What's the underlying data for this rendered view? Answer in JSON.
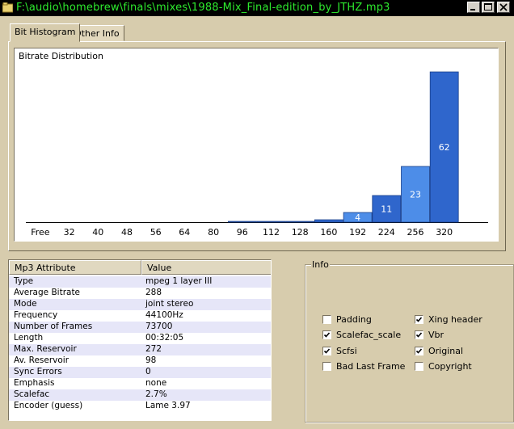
{
  "window": {
    "title": "F:\\audio\\homebrew\\finals\\mixes\\1988-Mix_Final-edition_by_JTHZ.mp3",
    "controls": [
      "minimize",
      "maximize",
      "close"
    ]
  },
  "tabs": [
    {
      "label": "Bit Histogram",
      "active": true
    },
    {
      "label": "Other Info",
      "active": false
    }
  ],
  "chart_data": {
    "type": "bar",
    "title": "Bitrate Distribution",
    "categories": [
      "Free",
      "32",
      "40",
      "48",
      "56",
      "64",
      "80",
      "96",
      "112",
      "128",
      "160",
      "192",
      "224",
      "256",
      "320"
    ],
    "values": [
      0,
      0,
      0,
      0,
      0,
      0,
      0,
      0.3,
      0.3,
      0.3,
      1,
      4,
      11,
      23,
      62
    ],
    "data_labels": [
      "",
      "",
      "",
      "",
      "",
      "",
      "",
      "",
      "",
      "",
      "",
      "4",
      "11",
      "23",
      "62"
    ],
    "ylim": [
      0,
      62
    ],
    "colors": {
      "bar_dark": "#2f66cc",
      "bar_light": "#4d8de8"
    },
    "grid": false
  },
  "attributes": {
    "columns": [
      "Mp3 Attribute",
      "Value"
    ],
    "rows": [
      [
        "Type",
        "mpeg 1 layer III"
      ],
      [
        "Average Bitrate",
        "288"
      ],
      [
        "Mode",
        "joint stereo"
      ],
      [
        "Frequency",
        "44100Hz"
      ],
      [
        "Number of Frames",
        "73700"
      ],
      [
        "Length",
        "00:32:05"
      ],
      [
        "Max. Reservoir",
        "272"
      ],
      [
        "Av. Reservoir",
        "98"
      ],
      [
        "Sync Errors",
        "0"
      ],
      [
        "Emphasis",
        "none"
      ],
      [
        "Scalefac",
        "2.7%"
      ],
      [
        "Encoder (guess)",
        "Lame 3.97"
      ]
    ]
  },
  "info": {
    "label": "Info",
    "checkboxes": [
      {
        "label": "Padding",
        "checked": false
      },
      {
        "label": "Xing header",
        "checked": true
      },
      {
        "label": "Scalefac_scale",
        "checked": true
      },
      {
        "label": "Vbr",
        "checked": true
      },
      {
        "label": "Scfsi",
        "checked": true
      },
      {
        "label": "Original",
        "checked": true
      },
      {
        "label": "Bad Last Frame",
        "checked": false
      },
      {
        "label": "Copyright",
        "checked": false
      }
    ]
  }
}
